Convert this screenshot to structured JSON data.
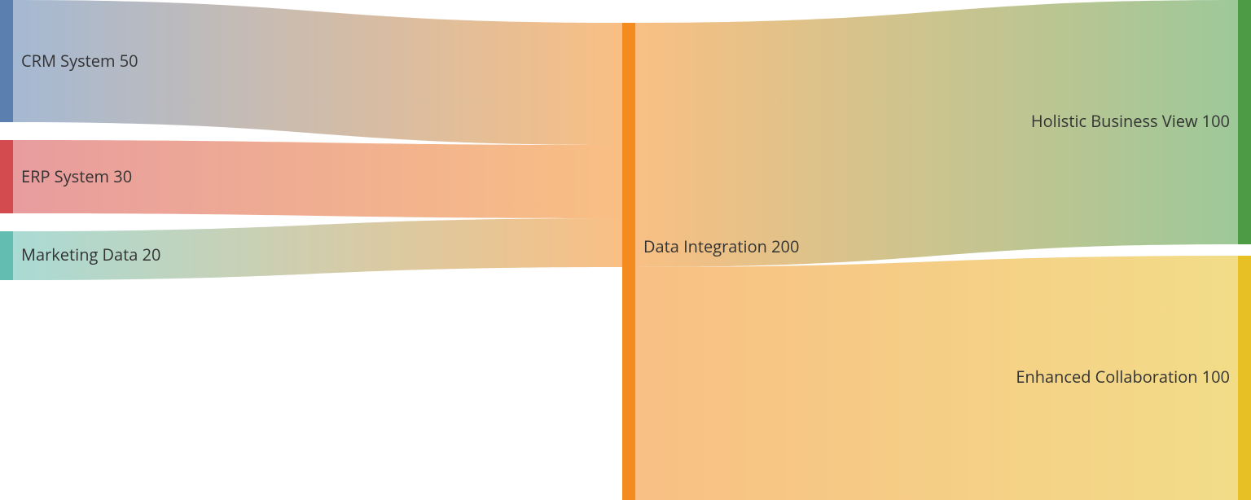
{
  "chart_data": {
    "type": "sankey",
    "nodes": [
      {
        "id": "crm",
        "name": "CRM System",
        "value": 50,
        "color": "#5b7fae",
        "col": 0
      },
      {
        "id": "erp",
        "name": "ERP System",
        "value": 30,
        "color": "#d44b4f",
        "col": 0
      },
      {
        "id": "mkt",
        "name": "Marketing Data",
        "value": 20,
        "color": "#64bdb1",
        "col": 0
      },
      {
        "id": "di",
        "name": "Data Integration",
        "value": 200,
        "color": "#f38b1e",
        "col": 1
      },
      {
        "id": "hbv",
        "name": "Holistic Business View",
        "value": 100,
        "color": "#4e9b45",
        "col": 2
      },
      {
        "id": "ecol",
        "name": "Enhanced Collaboration",
        "value": 100,
        "color": "#e7c026",
        "col": 2
      }
    ],
    "links": [
      {
        "source": "crm",
        "target": "di",
        "value": 50
      },
      {
        "source": "erp",
        "target": "di",
        "value": 30
      },
      {
        "source": "mkt",
        "target": "di",
        "value": 20
      },
      {
        "source": "di",
        "target": "hbv",
        "value": 100
      },
      {
        "source": "di",
        "target": "ecol",
        "value": 100
      }
    ]
  },
  "labels": {
    "crm": "CRM System 50",
    "erp": "ERP System 30",
    "mkt": "Marketing Data 20",
    "di": "Data Integration 200",
    "hbv": "Holistic Business View 100",
    "ecol": "Enhanced Collaboration 100"
  }
}
